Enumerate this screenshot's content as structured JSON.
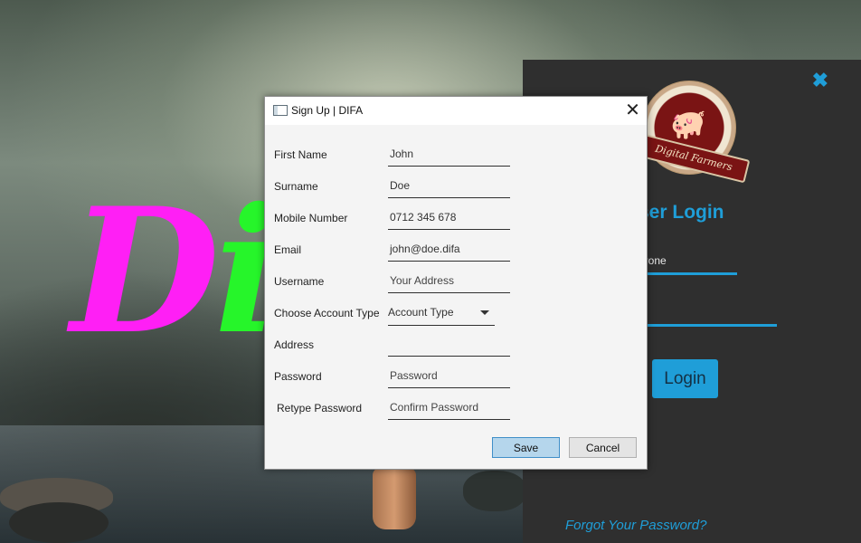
{
  "background": {
    "brand_text_1": "D",
    "brand_text_2": "i",
    "brand_color_1": "#ff1ff5",
    "brand_color_2": "#26f52a"
  },
  "login": {
    "close_icon": "close-icon",
    "logo_text": "Digital Farmers",
    "title": "ser Login",
    "username_value": "erone",
    "password_value": "•",
    "login_button": "Login",
    "forgot_link": "Forgot Your Password?",
    "accent_color": "#1f9ed8"
  },
  "dialog": {
    "title": "Sign Up | DIFA",
    "close_icon": "close-icon",
    "fields": {
      "first_name": {
        "label": "First Name",
        "value": "John"
      },
      "surname": {
        "label": "Surname",
        "value": "Doe"
      },
      "mobile": {
        "label": "Mobile Number",
        "value": "0712 345 678"
      },
      "email": {
        "label": "Email",
        "value": "john@doe.difa"
      },
      "username": {
        "label": "Username",
        "placeholder": "Your Address"
      },
      "account_type": {
        "label": "Choose Account Type",
        "placeholder": "Account Type"
      },
      "address": {
        "label": "Address",
        "value": ""
      },
      "password": {
        "label": "Password",
        "placeholder": "Password"
      },
      "retype_password": {
        "label": "Retype Password",
        "placeholder": "Confirm Password"
      }
    },
    "save_button": "Save",
    "cancel_button": "Cancel"
  }
}
